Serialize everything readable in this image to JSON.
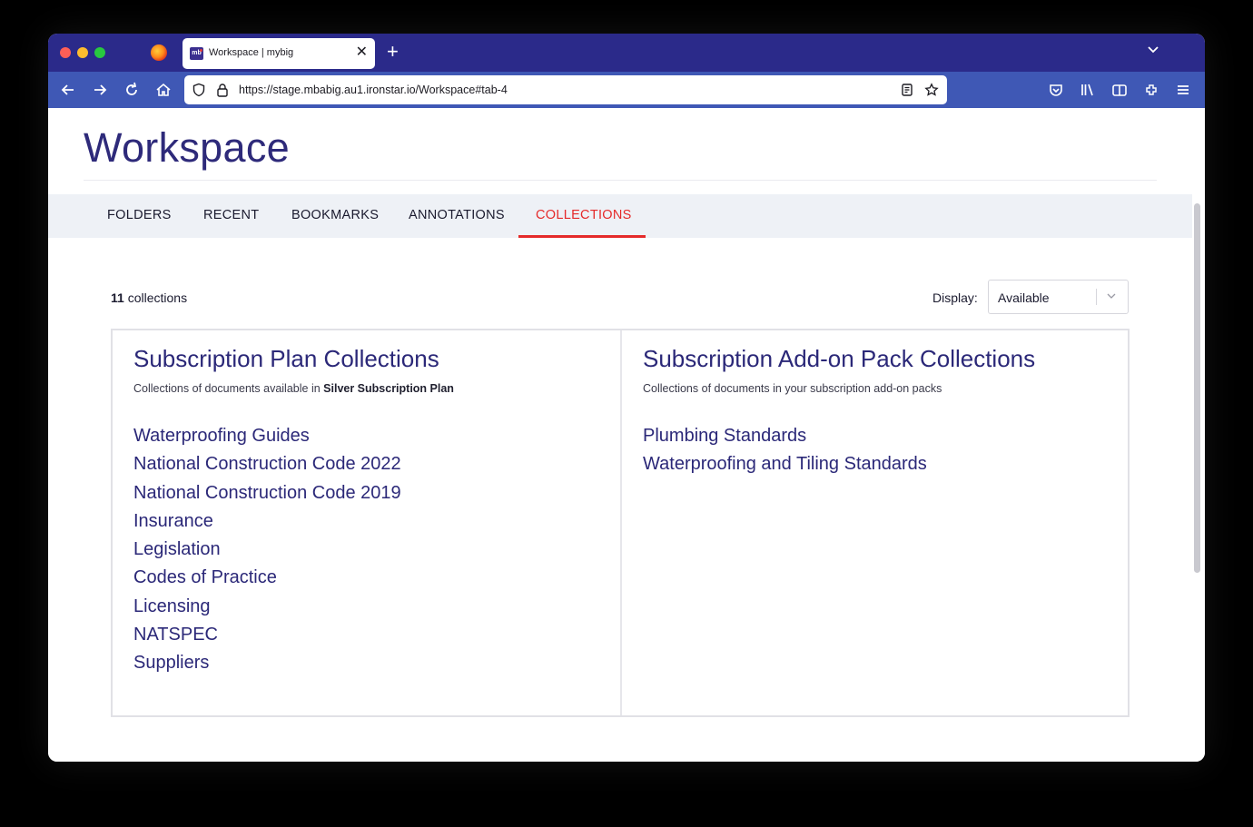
{
  "browser": {
    "tab_title": "Workspace | mybig",
    "tab_favicon_text": "mb",
    "url": "https://stage.mbabig.au1.ironstar.io/Workspace#tab-4",
    "icons": [
      "back-icon",
      "forward-icon",
      "reload-icon",
      "home-icon",
      "shield-icon",
      "lock-icon",
      "reader-view-icon",
      "bookmark-star-icon",
      "pocket-icon",
      "library-icon",
      "sidebar-icon",
      "extensions-icon",
      "menu-icon"
    ]
  },
  "page": {
    "title": "Workspace",
    "tabs": [
      {
        "label": "FOLDERS",
        "active": false
      },
      {
        "label": "RECENT",
        "active": false
      },
      {
        "label": "BOOKMARKS",
        "active": false
      },
      {
        "label": "ANNOTATIONS",
        "active": false
      },
      {
        "label": "COLLECTIONS",
        "active": true
      }
    ],
    "count_number": "11",
    "count_label": "collections",
    "display_label": "Display:",
    "display_value": "Available"
  },
  "plan": {
    "heading": "Subscription Plan Collections",
    "sub_prefix": "Collections of documents available in",
    "sub_plan": "Silver Subscription Plan",
    "items": [
      "Waterproofing Guides",
      "National Construction Code 2022",
      "National Construction Code 2019",
      "Insurance",
      "Legislation",
      "Codes of Practice",
      "Licensing",
      "NATSPEC",
      "Suppliers"
    ]
  },
  "addon": {
    "heading": "Subscription Add-on Pack Collections",
    "sub": "Collections of documents in your subscription add-on packs",
    "items": [
      "Plumbing Standards",
      "Waterproofing and Tiling Standards"
    ]
  },
  "colors": {
    "accent": "#e52a2a",
    "heading": "#2b2878",
    "tabbar": "#2b2a8a",
    "navbar": "#3f58b5"
  }
}
